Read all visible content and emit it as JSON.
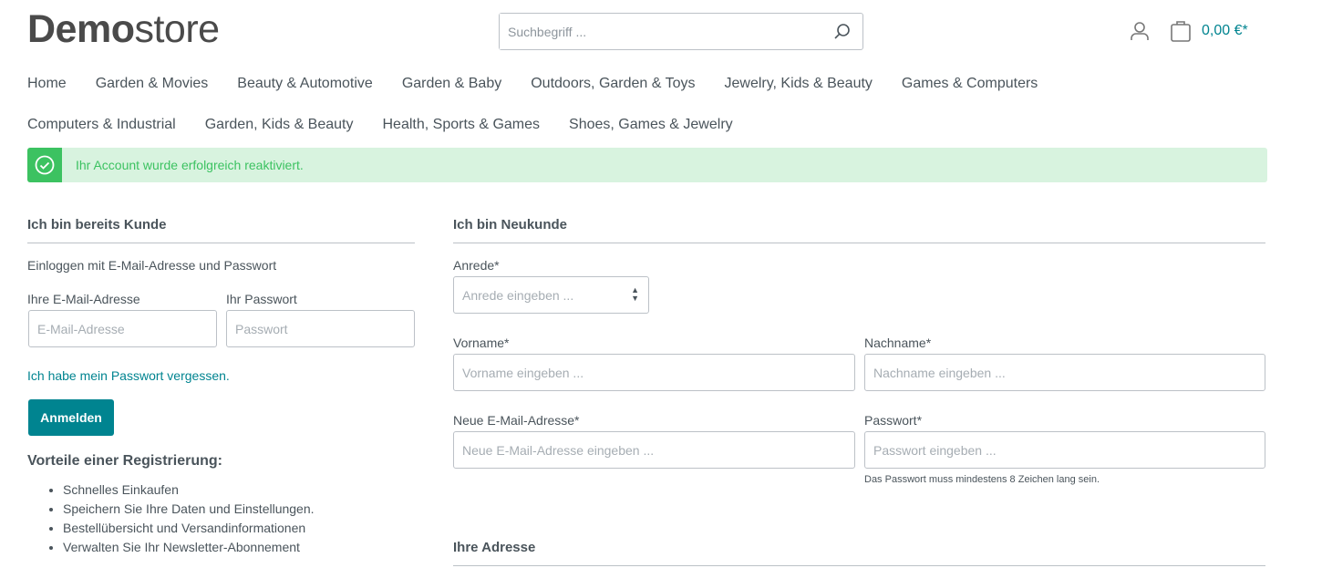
{
  "header": {
    "logo_bold": "Demo",
    "logo_light": "store",
    "search_placeholder": "Suchbegriff ...",
    "cart_total": "0,00 €*"
  },
  "nav": {
    "row1": [
      "Home",
      "Garden & Movies",
      "Beauty & Automotive",
      "Garden & Baby",
      "Outdoors, Garden & Toys",
      "Jewelry, Kids & Beauty",
      "Games & Computers"
    ],
    "row2": [
      "Computers & Industrial",
      "Garden, Kids & Beauty",
      "Health, Sports & Games",
      "Shoes, Games & Jewelry"
    ]
  },
  "alert": {
    "text": "Ihr Account wurde erfolgreich reaktiviert.",
    "color": "#3cc261"
  },
  "login": {
    "title": "Ich bin bereits Kunde",
    "intro": "Einloggen mit E-Mail-Adresse und Passwort",
    "email_label": "Ihre E-Mail-Adresse",
    "email_placeholder": "E-Mail-Adresse",
    "password_label": "Ihr Passwort",
    "password_placeholder": "Passwort",
    "forgot": "Ich habe mein Passwort vergessen.",
    "submit": "Anmelden",
    "benefits_title": "Vorteile einer Registrierung:",
    "benefits": [
      "Schnelles Einkaufen",
      "Speichern Sie Ihre Daten und Einstellungen.",
      "Bestellübersicht und Versandinformationen",
      "Verwalten Sie Ihr Newsletter-Abonnement"
    ]
  },
  "register": {
    "title": "Ich bin Neukunde",
    "salutation_label": "Anrede*",
    "salutation_placeholder": "Anrede eingeben ...",
    "firstname_label": "Vorname*",
    "firstname_placeholder": "Vorname eingeben ...",
    "lastname_label": "Nachname*",
    "lastname_placeholder": "Nachname eingeben ...",
    "email_label": "Neue E-Mail-Adresse*",
    "email_placeholder": "Neue E-Mail-Adresse eingeben ...",
    "password_label": "Passwort*",
    "password_placeholder": "Passwort eingeben ...",
    "password_hint": "Das Passwort muss mindestens 8 Zeichen lang sein.",
    "address_title": "Ihre Adresse"
  },
  "colors": {
    "accent": "#008490",
    "text": "#4a545b"
  }
}
